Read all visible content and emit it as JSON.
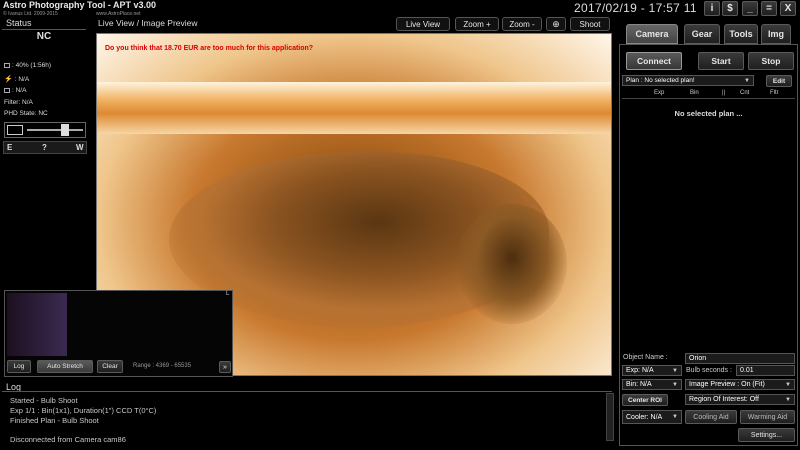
{
  "app": {
    "title": "Astro Photography Tool - APT v3.00",
    "copyright": "© Ivanus Ltd. 2009-2015",
    "website": "www.AstroPlace.net",
    "clock": "2017/02/19 - 17:57 11",
    "window_buttons": [
      "i",
      "$",
      "_",
      "=",
      "X"
    ]
  },
  "status": {
    "title": "Status",
    "camera_state": "NC",
    "battery": ": 40% (1:56h)",
    "power": ": N/A",
    "temperature": ": N/A",
    "filter": "Filter: N/A",
    "phd_state": "PHD State: NC",
    "flags": [
      "E",
      "?",
      "W"
    ]
  },
  "live_view": {
    "title": "Live View / Image Preview",
    "message": "Do you think that 18.70 EUR are too much for this application?",
    "buttons": {
      "live": "Live View",
      "zoom_in": "Zoom +",
      "zoom_out": "Zoom -",
      "shoot": "Shoot"
    }
  },
  "histogram": {
    "log_label": "Log",
    "auto_stretch_label": "Auto Stretch",
    "clear_label": "Clear",
    "range": "Range : 4369 - 65535",
    "corner_mark": "L"
  },
  "log": {
    "title": "Log",
    "entries": [
      "Started - Bulb Shoot",
      "Exp 1/1 : Bin(1x1), Duration(1\") CCD T(0°C)",
      "Finished Plan - Bulb Shoot",
      "",
      "Disconnected from Camera cam86"
    ]
  },
  "right": {
    "tabs": [
      "Camera",
      "Gear",
      "Tools",
      "Img"
    ],
    "connect": "Connect",
    "start": "Start",
    "stop": "Stop",
    "plan_select": "Plan : No selected plan!",
    "edit": "Edit",
    "plan_headers": [
      "Exp",
      "Bin",
      "||",
      "Cnt",
      "Fltr"
    ],
    "plan_empty": "No selected plan ...",
    "object_name_label": "Object Name :",
    "object_name": "Orion",
    "exp": "Exp: N/A",
    "bulb_seconds_label": "Bulb seconds :",
    "bulb_seconds": "0.01",
    "bin": "Bin: N/A",
    "image_preview": "Image Preview : On (Fit)",
    "center_roi": "Center ROI",
    "region_of_interest": "Region Of Interest: Off",
    "cooler": "Cooler: N/A",
    "cooling_aid": "Cooling Aid",
    "warming_aid": "Warming Aid",
    "settings": "Settings..."
  }
}
